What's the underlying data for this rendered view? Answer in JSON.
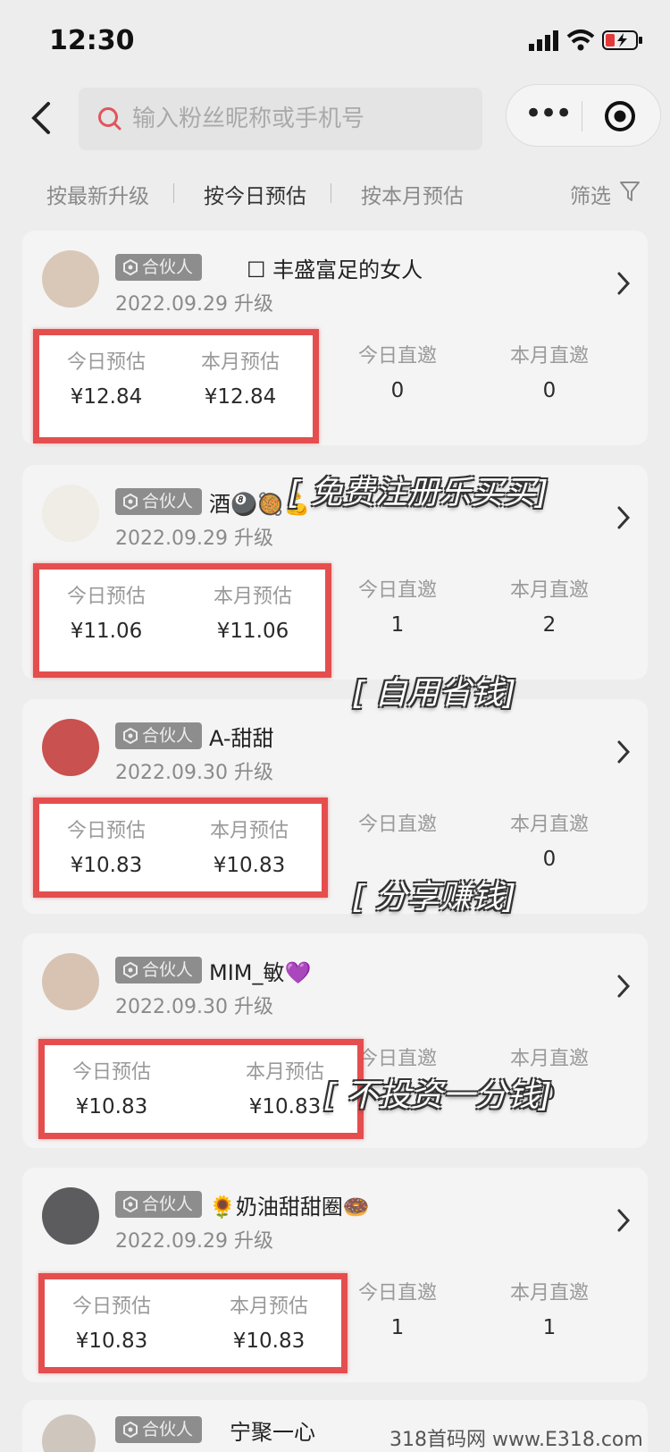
{
  "status_bar": {
    "time": "12:30"
  },
  "search": {
    "placeholder": "输入粉丝昵称或手机号"
  },
  "tabs": [
    {
      "label": "按最新升级",
      "active": false
    },
    {
      "label": "按今日预估",
      "active": true
    },
    {
      "label": "按本月预估",
      "active": false
    }
  ],
  "filter_label": "筛选",
  "column_labels": [
    "今日预估",
    "本月预估",
    "今日直邀",
    "本月直邀"
  ],
  "partner_badge": "合伙人",
  "members": [
    {
      "name": "☐  丰盛富足的女人",
      "date": "2022.09.29 升级",
      "today_est": "¥12.84",
      "month_est": "¥12.84",
      "today_invite": "0",
      "month_invite": "0"
    },
    {
      "name": "酒🎱🥘💪",
      "date": "2022.09.29 升级",
      "today_est": "¥11.06",
      "month_est": "¥11.06",
      "today_invite": "1",
      "month_invite": "2"
    },
    {
      "name": "A-甜甜",
      "date": "2022.09.30 升级",
      "today_est": "¥10.83",
      "month_est": "¥10.83",
      "today_invite": "",
      "month_invite": "0"
    },
    {
      "name": "MIM_敏💜",
      "date": "2022.09.30 升级",
      "today_est": "¥10.83",
      "month_est": "¥10.83",
      "today_invite": "",
      "month_invite": "0"
    },
    {
      "name": "🌻奶油甜甜圈🍩",
      "date": "2022.09.29 升级",
      "today_est": "¥10.83",
      "month_est": "¥10.83",
      "today_invite": "1",
      "month_invite": "1"
    }
  ],
  "partial_member": {
    "name": "宁聚一心"
  },
  "overlay_texts": [
    "[ 免费注册乐买买]",
    "[ 自用省钱]",
    "[ 分享赚钱]",
    "[ 不投资一分钱]"
  ],
  "watermark": "318首码网 www.E318.com",
  "colors": {
    "highlight_border": "#e44e4e",
    "badge_bg": "#8d8d8d",
    "page_bg": "#ededed"
  }
}
